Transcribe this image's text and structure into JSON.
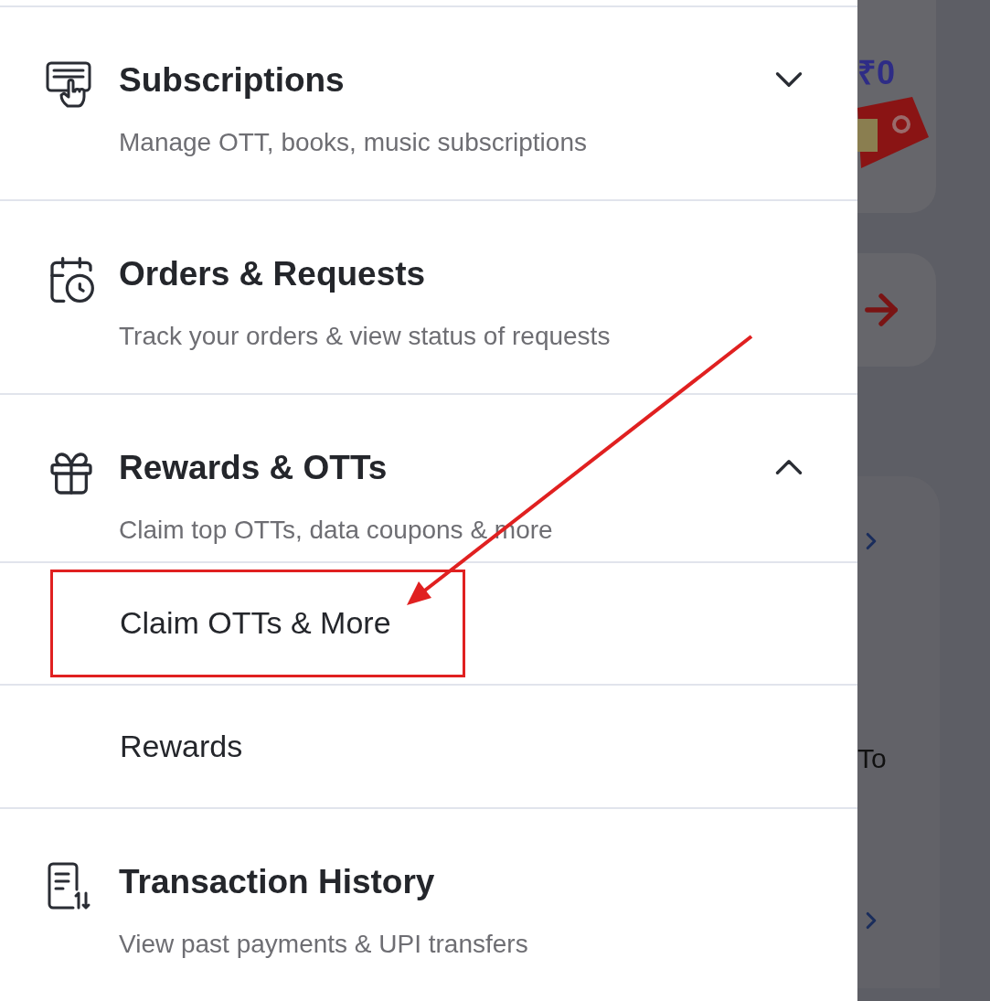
{
  "menu": {
    "items": [
      {
        "kind": "expandable",
        "title": "Subscriptions",
        "subtitle": "Manage OTT, books, music subscriptions",
        "expanded": false
      },
      {
        "kind": "link",
        "title": "Orders & Requests",
        "subtitle": "Track your orders & view status of requests"
      },
      {
        "kind": "expandable",
        "title": "Rewards & OTTs",
        "subtitle": "Claim top OTTs, data coupons & more",
        "expanded": true,
        "children": [
          {
            "label": "Claim OTTs & More",
            "highlighted": true
          },
          {
            "label": "Rewards",
            "highlighted": false
          }
        ]
      },
      {
        "kind": "link",
        "title": "Transaction History",
        "subtitle": "View past payments & UPI transfers"
      }
    ]
  },
  "background": {
    "price": "₹0",
    "card_text": "To"
  }
}
